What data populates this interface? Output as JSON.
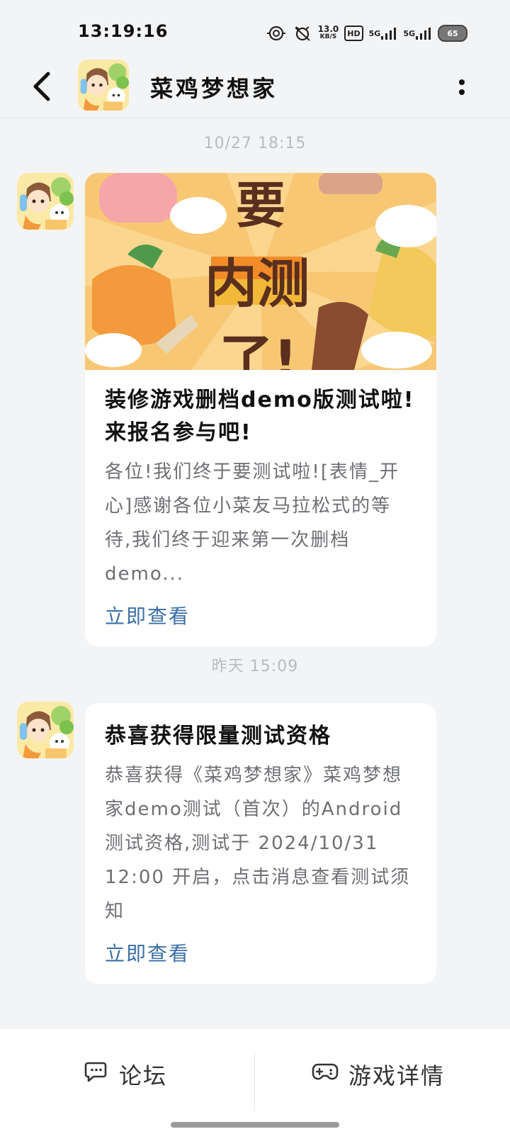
{
  "status_bar": {
    "time": "13:19:16",
    "net_speed": "13.0",
    "net_unit": "KB/S",
    "hd": "HD",
    "sig1": "5G",
    "sig2": "5G",
    "battery": "65",
    "icons": [
      "location-gear-icon",
      "alarm-mute-icon",
      "net-speed-icon",
      "hd-icon",
      "signal-5g-icon",
      "signal-5g-icon",
      "battery-icon"
    ]
  },
  "header": {
    "title": "菜鸡梦想家",
    "back_icon": "back-chevron-icon",
    "more_icon": "more-vertical-icon"
  },
  "messages": [
    {
      "timestamp": "10/27 18:15",
      "banner_text": [
        "要",
        "内测",
        "了!"
      ],
      "title": "装修游戏删档demo版测试啦!来报名参与吧!",
      "desc": "各位!我们终于要测试啦![表情_开心]感谢各位小菜友马拉松式的等待,我们终于迎来第一次删档demo...",
      "link": "立即查看"
    },
    {
      "timestamp": "昨天 15:09",
      "title": "恭喜获得限量测试资格",
      "desc": "恭喜获得《菜鸡梦想家》菜鸡梦想家demo测试（首次）的Android测试资格,测试于 2024/10/31 12:00 开启，点击消息查看测试须知",
      "link": "立即查看"
    }
  ],
  "bottom_bar": {
    "forum_label": "论坛",
    "details_label": "游戏详情",
    "forum_icon": "chat-bubble-icon",
    "details_icon": "gamepad-icon"
  },
  "colors": {
    "background": "#f3f4f6",
    "link": "#3b6fa4",
    "timestamp": "#b7bcc2",
    "banner_orange": "#f6a43b"
  }
}
